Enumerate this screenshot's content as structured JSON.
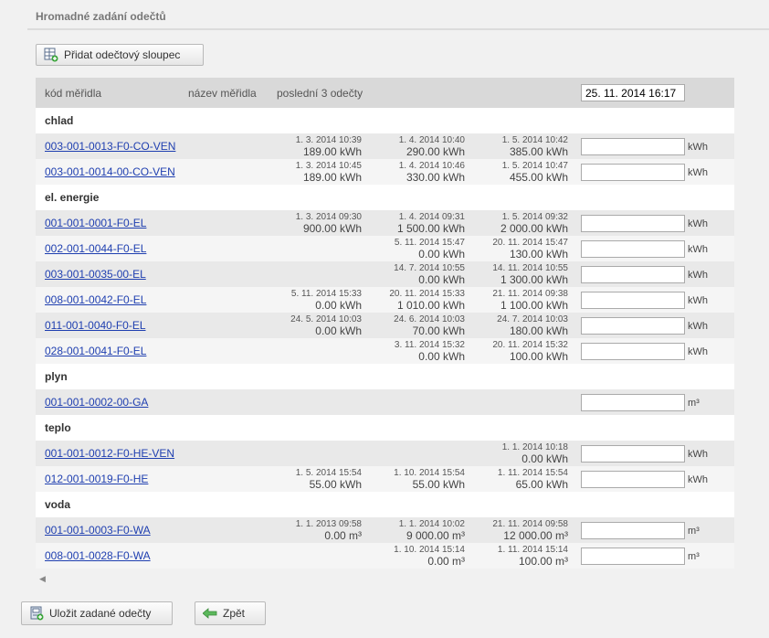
{
  "page": {
    "title": "Hromadné zadání odečtů",
    "add_column_label": "Přidat odečtový sloupec",
    "save_label": "Uložit zadané odečty",
    "back_label": "Zpět",
    "scroll_left_glyph": "◀"
  },
  "table": {
    "headers": {
      "code": "kód měřidla",
      "name": "název měřidla",
      "last3": "poslední 3 odečty"
    },
    "new_reading_datetime": "25. 11. 2014 16:17",
    "groups": [
      {
        "name": "chlad",
        "rows": [
          {
            "code": "003-001-0013-F0-CO-VEN",
            "unit": "kWh",
            "readings": [
              {
                "date": "1. 3. 2014 10:39",
                "value": "189.00 kWh"
              },
              {
                "date": "1. 4. 2014 10:40",
                "value": "290.00 kWh"
              },
              {
                "date": "1. 5. 2014 10:42",
                "value": "385.00 kWh"
              }
            ]
          },
          {
            "code": "003-001-0014-00-CO-VEN",
            "unit": "kWh",
            "readings": [
              {
                "date": "1. 3. 2014 10:45",
                "value": "189.00 kWh"
              },
              {
                "date": "1. 4. 2014 10:46",
                "value": "330.00 kWh"
              },
              {
                "date": "1. 5. 2014 10:47",
                "value": "455.00 kWh"
              }
            ]
          }
        ]
      },
      {
        "name": "el. energie",
        "rows": [
          {
            "code": "001-001-0001-F0-EL",
            "unit": "kWh",
            "readings": [
              {
                "date": "1. 3. 2014 09:30",
                "value": "900.00 kWh"
              },
              {
                "date": "1. 4. 2014 09:31",
                "value": "1 500.00 kWh"
              },
              {
                "date": "1. 5. 2014 09:32",
                "value": "2 000.00 kWh"
              }
            ]
          },
          {
            "code": "002-001-0044-F0-EL",
            "unit": "kWh",
            "readings": [
              {
                "date": "",
                "value": ""
              },
              {
                "date": "5. 11. 2014 15:47",
                "value": "0.00 kWh"
              },
              {
                "date": "20. 11. 2014 15:47",
                "value": "130.00 kWh"
              }
            ]
          },
          {
            "code": "003-001-0035-00-EL",
            "unit": "kWh",
            "readings": [
              {
                "date": "",
                "value": ""
              },
              {
                "date": "14. 7. 2014 10:55",
                "value": "0.00 kWh"
              },
              {
                "date": "14. 11. 2014 10:55",
                "value": "1 300.00 kWh"
              }
            ]
          },
          {
            "code": "008-001-0042-F0-EL",
            "unit": "kWh",
            "readings": [
              {
                "date": "5. 11. 2014 15:33",
                "value": "0.00 kWh"
              },
              {
                "date": "20. 11. 2014 15:33",
                "value": "1 010.00 kWh"
              },
              {
                "date": "21. 11. 2014 09:38",
                "value": "1 100.00 kWh"
              }
            ]
          },
          {
            "code": "011-001-0040-F0-EL",
            "unit": "kWh",
            "readings": [
              {
                "date": "24. 5. 2014 10:03",
                "value": "0.00 kWh"
              },
              {
                "date": "24. 6. 2014 10:03",
                "value": "70.00 kWh"
              },
              {
                "date": "24. 7. 2014 10:03",
                "value": "180.00 kWh"
              }
            ]
          },
          {
            "code": "028-001-0041-F0-EL",
            "unit": "kWh",
            "readings": [
              {
                "date": "",
                "value": ""
              },
              {
                "date": "3. 11. 2014 15:32",
                "value": "0.00 kWh"
              },
              {
                "date": "20. 11. 2014 15:32",
                "value": "100.00 kWh"
              }
            ]
          }
        ]
      },
      {
        "name": "plyn",
        "rows": [
          {
            "code": "001-001-0002-00-GA",
            "unit": "m³",
            "readings": [
              {
                "date": "",
                "value": ""
              },
              {
                "date": "",
                "value": ""
              },
              {
                "date": "",
                "value": ""
              }
            ]
          }
        ]
      },
      {
        "name": "teplo",
        "rows": [
          {
            "code": "001-001-0012-F0-HE-VEN",
            "unit": "kWh",
            "readings": [
              {
                "date": "",
                "value": ""
              },
              {
                "date": "",
                "value": ""
              },
              {
                "date": "1. 1. 2014 10:18",
                "value": "0.00 kWh"
              }
            ]
          },
          {
            "code": "012-001-0019-F0-HE",
            "unit": "kWh",
            "readings": [
              {
                "date": "1. 5. 2014 15:54",
                "value": "55.00 kWh"
              },
              {
                "date": "1. 10. 2014 15:54",
                "value": "55.00 kWh"
              },
              {
                "date": "1. 11. 2014 15:54",
                "value": "65.00 kWh"
              }
            ]
          }
        ]
      },
      {
        "name": "voda",
        "rows": [
          {
            "code": "001-001-0003-F0-WA",
            "unit": "m³",
            "readings": [
              {
                "date": "1. 1. 2013 09:58",
                "value": "0.00 m³"
              },
              {
                "date": "1. 1. 2014 10:02",
                "value": "9 000.00 m³"
              },
              {
                "date": "21. 11. 2014 09:58",
                "value": "12 000.00 m³"
              }
            ]
          },
          {
            "code": "008-001-0028-F0-WA",
            "unit": "m³",
            "readings": [
              {
                "date": "",
                "value": ""
              },
              {
                "date": "1. 10. 2014 15:14",
                "value": "0.00 m³"
              },
              {
                "date": "1. 11. 2014 15:14",
                "value": "100.00 m³"
              }
            ]
          }
        ]
      }
    ]
  }
}
